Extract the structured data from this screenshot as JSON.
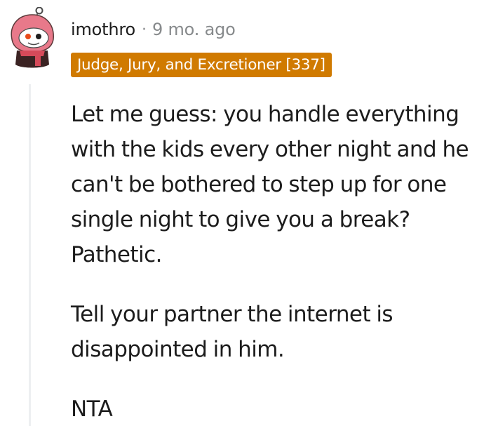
{
  "comment": {
    "author": "imothro",
    "separator": "·",
    "timestamp": "9 mo. ago",
    "flair": "Judge, Jury, and Excretioner [337]",
    "avatar_icon": "snoo-avatar-icon",
    "paragraphs": [
      "Let me guess: you handle everything with the kids every other night and he can't be bothered to step up for one single night to give you a break? Pathetic.",
      "Tell your partner the internet is disappointed in him.",
      "NTA"
    ]
  },
  "colors": {
    "flair_background": "#d07a00",
    "flair_text": "#ffffff",
    "meta_text": "#878a8c",
    "body_text": "#1c1c1c",
    "thread_line": "#edeff1",
    "avatar_hood": "#e8798a"
  }
}
